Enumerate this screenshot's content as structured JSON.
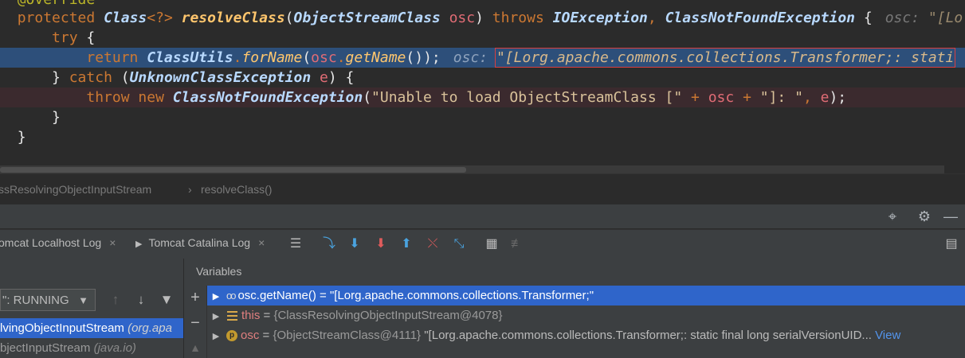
{
  "editor": {
    "lines": {
      "override": "@Override",
      "sig_protected": "protected",
      "sig_class": "Class",
      "sig_generic": "<?>",
      "sig_method": "resolveClass",
      "sig_paren_open": "(",
      "sig_param_type": "ObjectStreamClass",
      "sig_param": "osc",
      "sig_paren_close": ")",
      "sig_throws": "throws",
      "sig_ex1": "IOException",
      "sig_comma": ",",
      "sig_ex2": "ClassNotFoundException",
      "sig_brace": "{",
      "sig_hint_label": "osc:",
      "sig_hint_value": "\"[Lo",
      "try_kw": "try",
      "try_brace": "{",
      "ret_kw": "return",
      "ret_class": "ClassUtils",
      "ret_dot1": ".",
      "ret_method": "forName",
      "ret_paren": "(",
      "ret_arg": "osc",
      "ret_dot2": ".",
      "ret_getname": "getName",
      "ret_call": "()",
      "ret_close": ");",
      "ret_hint_label": "osc:",
      "ret_hint_value": "\"[Lorg.apache.commons.collections.Transformer;: stati",
      "catch_brace": "}",
      "catch_kw": "catch",
      "catch_paren": "(",
      "catch_type": "UnknownClassException",
      "catch_var": "e",
      "catch_close": ") {",
      "throw_kw": "throw",
      "throw_new": "new",
      "throw_type": "ClassNotFoundException",
      "throw_paren": "(",
      "throw_str1": "\"Unable to load ObjectStreamClass [\"",
      "throw_plus1": "+",
      "throw_osc": "osc",
      "throw_plus2": "+",
      "throw_str2": "\"]: \"",
      "throw_comma": ",",
      "throw_e": "e",
      "throw_close": ");",
      "close_inner": "}",
      "close_outer": "}"
    }
  },
  "breadcrumb": {
    "class_name": "ssResolvingObjectInputStream",
    "separator": "›",
    "method": "resolveClass()"
  },
  "debug": {
    "tabs": [
      {
        "label": "omcat Localhost Log",
        "close": "×"
      },
      {
        "label": "Tomcat Catalina Log",
        "close": "×"
      }
    ],
    "frames": {
      "thread": "\": RUNNING",
      "items": [
        {
          "name": "lvingObjectInputStream",
          "pkg": "(org.apa"
        },
        {
          "name": "bjectInputStream",
          "pkg": "(java.io)"
        }
      ]
    },
    "variables": {
      "title": "Variables",
      "rows": [
        {
          "name": "osc.getName()",
          "eq": " = ",
          "value": "\"[Lorg.apache.commons.collections.Transformer;\""
        },
        {
          "name": "this",
          "eq": " = ",
          "type": "{ClassResolvingObjectInputStream@4078}"
        },
        {
          "name": "osc",
          "eq": " = ",
          "type": "{ObjectStreamClass@4111}",
          "value": " \"[Lorg.apache.commons.collections.Transformer;: static final long serialVersionUID...",
          "link": "View"
        }
      ]
    }
  }
}
